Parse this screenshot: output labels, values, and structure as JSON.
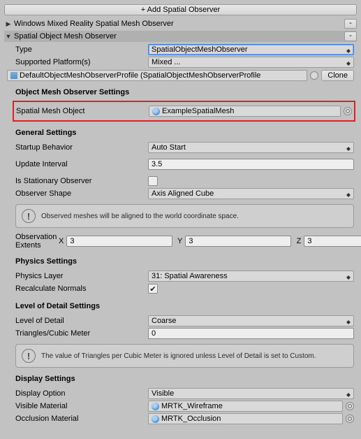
{
  "top_button": "+ Add Spatial Observer",
  "collapsed_header": "Windows Mixed Reality Spatial Mesh Observer",
  "observer": {
    "title": "Spatial Object Mesh Observer",
    "type": {
      "label": "Type",
      "value": "SpatialObjectMeshObserver"
    },
    "platforms": {
      "label": "Supported Platform(s)",
      "value": "Mixed ..."
    },
    "profile": {
      "value": "DefaultObjectMeshObserverProfile (SpatialObjectMeshObserverProfile",
      "clone": "Clone"
    },
    "settings_heading": "Object Mesh Observer Settings",
    "spatial_mesh": {
      "label": "Spatial Mesh Object",
      "value": "ExampleSpatialMesh"
    },
    "general": {
      "heading": "General Settings",
      "startup": {
        "label": "Startup Behavior",
        "value": "Auto Start"
      },
      "interval": {
        "label": "Update Interval",
        "value": "3.5"
      },
      "stationary": {
        "label": "Is Stationary Observer",
        "checked": false
      },
      "shape": {
        "label": "Observer Shape",
        "value": "Axis Aligned Cube"
      },
      "info": "Observed meshes will be aligned to the world coordinate space.",
      "extents": {
        "label": "Observation Extents",
        "x": "3",
        "y": "3",
        "z": "3"
      }
    },
    "physics": {
      "heading": "Physics Settings",
      "layer": {
        "label": "Physics Layer",
        "value": "31: Spatial Awareness"
      },
      "recalc": {
        "label": "Recalculate Normals",
        "checked": true
      }
    },
    "lod": {
      "heading": "Level of Detail Settings",
      "level": {
        "label": "Level of Detail",
        "value": "Coarse"
      },
      "triangles": {
        "label": "Triangles/Cubic Meter",
        "value": "0"
      },
      "info": "The value of Triangles per Cubic Meter is ignored unless Level of Detail is set to Custom."
    },
    "display": {
      "heading": "Display Settings",
      "option": {
        "label": "Display Option",
        "value": "Visible"
      },
      "visible_mat": {
        "label": "Visible Material",
        "value": "MRTK_Wireframe"
      },
      "occlusion_mat": {
        "label": "Occlusion Material",
        "value": "MRTK_Occlusion"
      }
    }
  }
}
